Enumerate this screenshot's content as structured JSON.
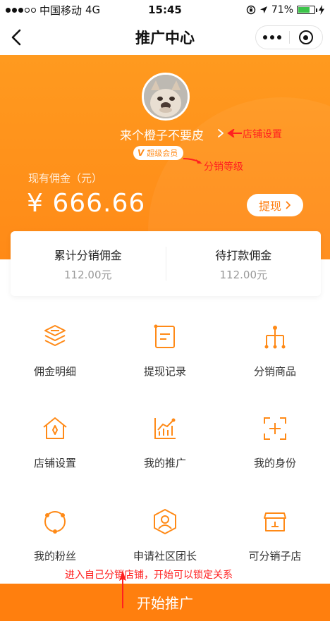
{
  "status_bar": {
    "carrier": "中国移动",
    "network": "4G",
    "time": "15:45",
    "battery": "71%",
    "battery_level": 0.71
  },
  "nav": {
    "title": "推广中心"
  },
  "profile": {
    "name": "来个橙子不要皮",
    "badge_icon": "V",
    "level": "超级会员"
  },
  "commission": {
    "label": "现有佣金（元）",
    "amount": "¥ 666.66",
    "withdraw_label": "提现"
  },
  "stats": [
    {
      "label": "累计分销佣金",
      "value": "112.00元"
    },
    {
      "label": "待打款佣金",
      "value": "112.00元"
    }
  ],
  "menu": [
    {
      "label": "佣金明细",
      "icon": "layers-icon"
    },
    {
      "label": "提现记录",
      "icon": "record-icon"
    },
    {
      "label": "分销商品",
      "icon": "tree-icon"
    },
    {
      "label": "店铺设置",
      "icon": "store-icon"
    },
    {
      "label": "我的推广",
      "icon": "chart-icon"
    },
    {
      "label": "我的身份",
      "icon": "identity-icon"
    },
    {
      "label": "我的粉丝",
      "icon": "fans-icon"
    },
    {
      "label": "申请社区团长",
      "icon": "leader-icon"
    },
    {
      "label": "可分销子店",
      "icon": "substore-icon"
    }
  ],
  "annotations": {
    "store_settings": "店铺设置",
    "distribution_level": "分销等级",
    "start_hint": "进入自己分销店铺，开始可以锁定关系"
  },
  "footer": {
    "start_label": "开始推广"
  },
  "colors": {
    "accent": "#ff8a17",
    "annotation": "#ff2020"
  }
}
